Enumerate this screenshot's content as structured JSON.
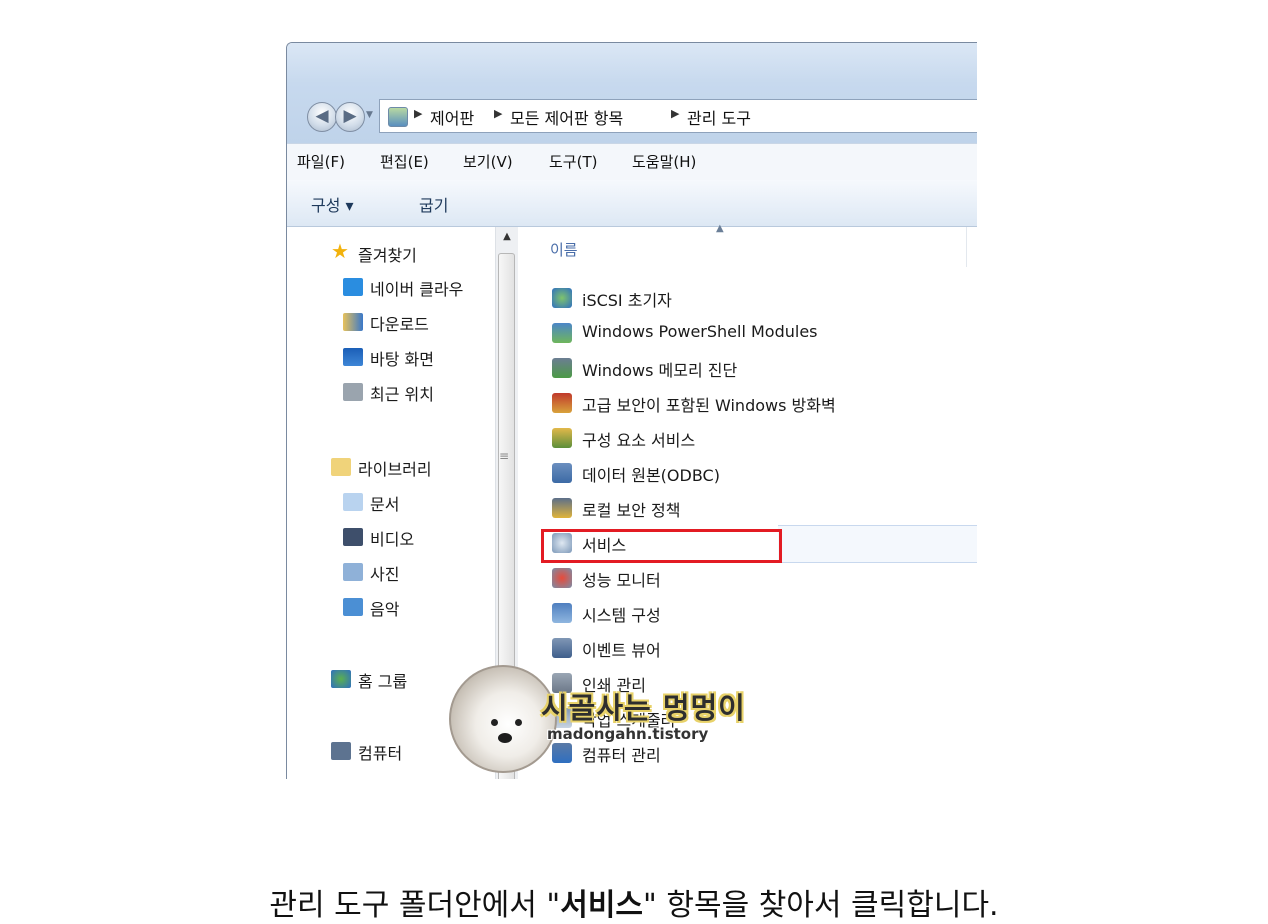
{
  "address_bar": {
    "breadcrumbs": [
      "제어판",
      "모든 제어판 항목",
      "관리 도구"
    ]
  },
  "menu_bar": [
    "파일(F)",
    "편집(E)",
    "보기(V)",
    "도구(T)",
    "도움말(H)"
  ],
  "command_bar": {
    "organize_label": "구성 ▾",
    "burn_label": "굽기"
  },
  "nav_pane": {
    "items": [
      {
        "label": "즐겨찾기",
        "icon": "star-icon"
      },
      {
        "label": "네이버 클라우",
        "icon": "cloud-icon"
      },
      {
        "label": "다운로드",
        "icon": "download-folder-icon"
      },
      {
        "label": "바탕 화면",
        "icon": "desktop-icon"
      },
      {
        "label": "최근 위치",
        "icon": "recent-places-icon"
      },
      {
        "label": "라이브러리",
        "icon": "library-icon"
      },
      {
        "label": "문서",
        "icon": "documents-icon"
      },
      {
        "label": "비디오",
        "icon": "videos-icon"
      },
      {
        "label": "사진",
        "icon": "pictures-icon"
      },
      {
        "label": "음악",
        "icon": "music-icon"
      },
      {
        "label": "홈 그룹",
        "icon": "homegroup-icon"
      },
      {
        "label": "컴퓨터",
        "icon": "computer-icon"
      }
    ]
  },
  "content": {
    "column_header": "이름",
    "items": [
      {
        "label": "iSCSI 초기자",
        "icon": "iscsi-icon"
      },
      {
        "label": "Windows PowerShell Modules",
        "icon": "powershell-icon"
      },
      {
        "label": "Windows 메모리 진단",
        "icon": "memory-diagnostic-icon"
      },
      {
        "label": "고급 보안이 포함된 Windows 방화벽",
        "icon": "firewall-icon"
      },
      {
        "label": "구성 요소 서비스",
        "icon": "component-services-icon"
      },
      {
        "label": "데이터 원본(ODBC)",
        "icon": "odbc-icon"
      },
      {
        "label": "로컬 보안 정책",
        "icon": "security-policy-icon"
      },
      {
        "label": "서비스",
        "icon": "services-icon"
      },
      {
        "label": "성능 모니터",
        "icon": "performance-monitor-icon"
      },
      {
        "label": "시스템 구성",
        "icon": "system-configuration-icon"
      },
      {
        "label": "이벤트 뷰어",
        "icon": "event-viewer-icon"
      },
      {
        "label": "인쇄 관리",
        "icon": "print-management-icon"
      },
      {
        "label": "작업 스케줄러",
        "icon": "task-scheduler-icon"
      },
      {
        "label": "컴퓨터 관리",
        "icon": "computer-management-icon"
      }
    ]
  },
  "watermark": {
    "title": "시골사는 멍멍이",
    "subtitle": "madongahn.tistory"
  },
  "caption": {
    "before": "관리 도구 폴더안에서 \"",
    "bold": "서비스",
    "after": "\" 항목을 찾아서 클릭합니다."
  },
  "colors": {
    "highlight": "#e31b23",
    "link_header": "#4a6ea9"
  }
}
